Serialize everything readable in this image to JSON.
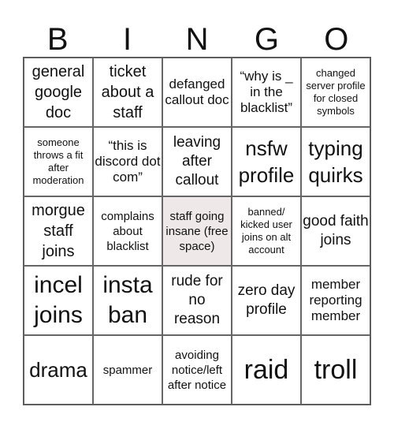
{
  "header": {
    "letters": [
      "B",
      "I",
      "N",
      "G",
      "O"
    ]
  },
  "board": {
    "free_space_color": "#eee8e8",
    "rows": [
      [
        {
          "text": "general google doc"
        },
        {
          "text": "ticket about a staff"
        },
        {
          "text": "defanged callout doc"
        },
        {
          "text": "“why is _ in the blacklist”"
        },
        {
          "text": "changed server profile for closed symbols"
        }
      ],
      [
        {
          "text": "someone throws a fit after moderation"
        },
        {
          "text": "“this is discord dot com”"
        },
        {
          "text": "leaving after callout"
        },
        {
          "text": "nsfw profile"
        },
        {
          "text": "typing quirks"
        }
      ],
      [
        {
          "text": "morgue staff joins"
        },
        {
          "text": "complains about blacklist"
        },
        {
          "text": "staff going insane (free space)",
          "free": true
        },
        {
          "text": "banned/ kicked user joins on alt account"
        },
        {
          "text": "good faith joins"
        }
      ],
      [
        {
          "text": "incel joins"
        },
        {
          "text": "insta ban"
        },
        {
          "text": "rude for no reason"
        },
        {
          "text": "zero day profile"
        },
        {
          "text": "member reporting member"
        }
      ],
      [
        {
          "text": "drama"
        },
        {
          "text": "spammer"
        },
        {
          "text": "avoiding notice/left after notice"
        },
        {
          "text": "raid"
        },
        {
          "text": "troll"
        }
      ]
    ]
  }
}
